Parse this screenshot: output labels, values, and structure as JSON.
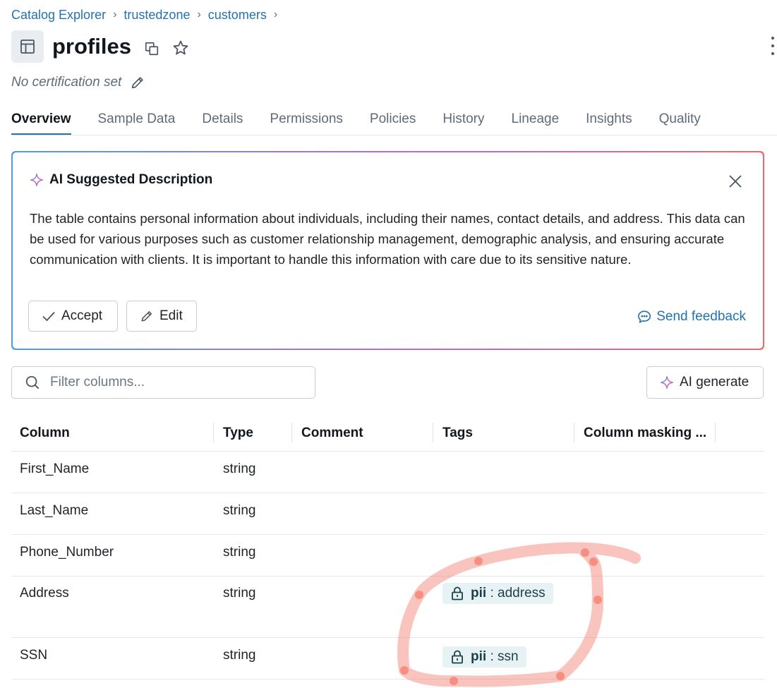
{
  "breadcrumb": [
    "Catalog Explorer",
    "trustedzone",
    "customers"
  ],
  "header": {
    "title": "profiles",
    "certification": "No certification set"
  },
  "tabs": [
    "Overview",
    "Sample Data",
    "Details",
    "Permissions",
    "Policies",
    "History",
    "Lineage",
    "Insights",
    "Quality"
  ],
  "active_tab": "Overview",
  "ai_description": {
    "title": "AI Suggested Description",
    "body": "The table contains personal information about individuals, including their names, contact details, and address. This data can be used for various purposes such as customer relationship management, demographic analysis, and ensuring accurate communication with clients. It is important to handle this information with care due to its sensitive nature.",
    "accept_label": "Accept",
    "edit_label": "Edit",
    "feedback_label": "Send feedback"
  },
  "filter": {
    "placeholder": "Filter columns..."
  },
  "ai_generate_label": "AI generate",
  "table": {
    "headers": [
      "Column",
      "Type",
      "Comment",
      "Tags",
      "Column masking ..."
    ],
    "rows": [
      {
        "column": "First_Name",
        "type": "string",
        "comment": "",
        "tag_key": "",
        "tag_value": ""
      },
      {
        "column": "Last_Name",
        "type": "string",
        "comment": "",
        "tag_key": "",
        "tag_value": ""
      },
      {
        "column": "Phone_Number",
        "type": "string",
        "comment": "",
        "tag_key": "",
        "tag_value": ""
      },
      {
        "column": "Address",
        "type": "string",
        "comment": "",
        "tag_key": "pii",
        "tag_value": "address"
      },
      {
        "column": "SSN",
        "type": "string",
        "comment": "",
        "tag_key": "pii",
        "tag_value": "ssn"
      }
    ]
  },
  "colors": {
    "link": "#2272b4",
    "annotation": "#f47c6e",
    "tag_bg": "#e6f2f4"
  },
  "icons": [
    "table-icon",
    "copy-icon",
    "star-icon",
    "kebab-icon",
    "pencil-icon",
    "sparkle-icon",
    "close-icon",
    "check-icon",
    "chat-icon",
    "search-icon",
    "lock-icon"
  ]
}
